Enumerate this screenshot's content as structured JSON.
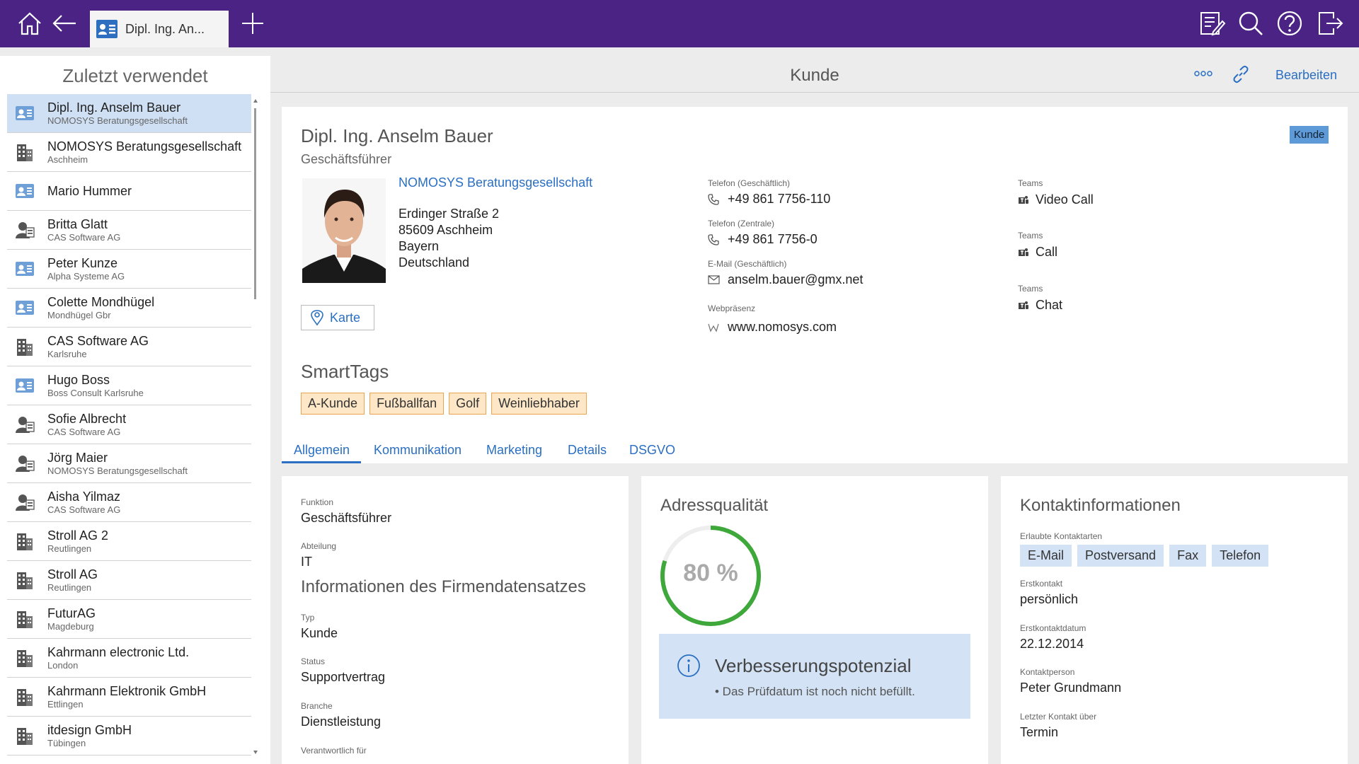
{
  "topbar": {
    "tab_title": "Dipl. Ing. An...",
    "icons": [
      "home-icon",
      "back-icon",
      "add-tab-icon",
      "notes-icon",
      "search-icon",
      "help-icon",
      "logout-icon"
    ],
    "color": "#4a2384"
  },
  "sidebar": {
    "title": "Zuletzt verwendet",
    "items": [
      {
        "name": "Dipl. Ing. Anselm Bauer",
        "sub": "NOMOSYS Beratungsgesellschaft",
        "type": "contact",
        "selected": true
      },
      {
        "name": "NOMOSYS Beratungsgesellschaft",
        "sub": "Aschheim",
        "type": "company"
      },
      {
        "name": "Mario Hummer",
        "sub": "",
        "type": "contact"
      },
      {
        "name": "Britta Glatt",
        "sub": "CAS Software AG",
        "type": "person"
      },
      {
        "name": "Peter Kunze",
        "sub": "Alpha Systeme AG",
        "type": "contact"
      },
      {
        "name": "Colette Mondhügel",
        "sub": "Mondhügel Gbr",
        "type": "contact"
      },
      {
        "name": "CAS Software AG",
        "sub": "Karlsruhe",
        "type": "company"
      },
      {
        "name": "Hugo Boss",
        "sub": "Boss Consult Karlsruhe",
        "type": "contact"
      },
      {
        "name": "Sofie Albrecht",
        "sub": "CAS Software AG",
        "type": "person"
      },
      {
        "name": "Jörg Maier",
        "sub": "NOMOSYS Beratungsgesellschaft",
        "type": "person"
      },
      {
        "name": "Aisha Yilmaz",
        "sub": "CAS Software AG",
        "type": "person"
      },
      {
        "name": "Stroll AG 2",
        "sub": "Reutlingen",
        "type": "company"
      },
      {
        "name": "Stroll AG",
        "sub": "Reutlingen",
        "type": "company"
      },
      {
        "name": "FuturAG",
        "sub": "Magdeburg",
        "type": "company"
      },
      {
        "name": "Kahrmann electronic Ltd.",
        "sub": "London",
        "type": "company"
      },
      {
        "name": "Kahrmann Elektronik GmbH",
        "sub": "Ettlingen",
        "type": "company"
      },
      {
        "name": "itdesign GmbH",
        "sub": "Tübingen",
        "type": "company"
      }
    ]
  },
  "header": {
    "title": "Kunde",
    "edit_label": "Bearbeiten",
    "icons": [
      "more-icon",
      "link-icon"
    ]
  },
  "person": {
    "name": "Dipl. Ing. Anselm Bauer",
    "position": "Geschäftsführer",
    "badge": "Kunde",
    "company": "NOMOSYS Beratungsgesellschaft",
    "address": [
      "Erdinger Straße 2",
      "85609 Aschheim",
      "Bayern",
      "Deutschland"
    ],
    "map_button": "Karte"
  },
  "contact": {
    "phone_business_label": "Telefon (Geschäftlich)",
    "phone_business": "+49 861 7756-110",
    "phone_central_label": "Telefon (Zentrale)",
    "phone_central": "+49 861 7756-0",
    "email_label": "E-Mail (Geschäftlich)",
    "email": "anselm.bauer@gmx.net",
    "web_label": "Webpräsenz",
    "web": "www.nomosys.com"
  },
  "teams": [
    {
      "label": "Teams",
      "action": "Video Call"
    },
    {
      "label": "Teams",
      "action": "Call"
    },
    {
      "label": "Teams",
      "action": "Chat"
    }
  ],
  "smarttags": {
    "title": "SmartTags",
    "tags": [
      "A-Kunde",
      "Fußballfan",
      "Golf",
      "Weinliebhaber"
    ]
  },
  "tabs": [
    "Allgemein",
    "Kommunikation",
    "Marketing",
    "Details",
    "DSGVO"
  ],
  "general": {
    "funktion_label": "Funktion",
    "funktion": "Geschäftsführer",
    "abteilung_label": "Abteilung",
    "abteilung": "IT",
    "section_title": "Informationen des Firmendatensatzes",
    "typ_label": "Typ",
    "typ": "Kunde",
    "status_label": "Status",
    "status": "Supportvertrag",
    "branche_label": "Branche",
    "branche": "Dienstleistung",
    "verantwortlich_label": "Verantwortlich für"
  },
  "address_quality": {
    "title": "Adressqualität",
    "percent": 80,
    "percent_text": "80 %",
    "hint_title": "Verbesserungspotenzial",
    "hint_text": "• Das Prüfdatum ist noch nicht befüllt.",
    "color": "#3ea83a"
  },
  "contact_info": {
    "title": "Kontaktinformationen",
    "allowed_label": "Erlaubte Kontaktarten",
    "allowed": [
      "E-Mail",
      "Postversand",
      "Fax",
      "Telefon"
    ],
    "erstkontakt_label": "Erstkontakt",
    "erstkontakt": "persönlich",
    "erstkontaktdatum_label": "Erstkontaktdatum",
    "erstkontaktdatum": "22.12.2014",
    "kontaktperson_label": "Kontaktperson",
    "kontaktperson": "Peter Grundmann",
    "letzter_label": "Letzter Kontakt über",
    "letzter": "Termin"
  }
}
